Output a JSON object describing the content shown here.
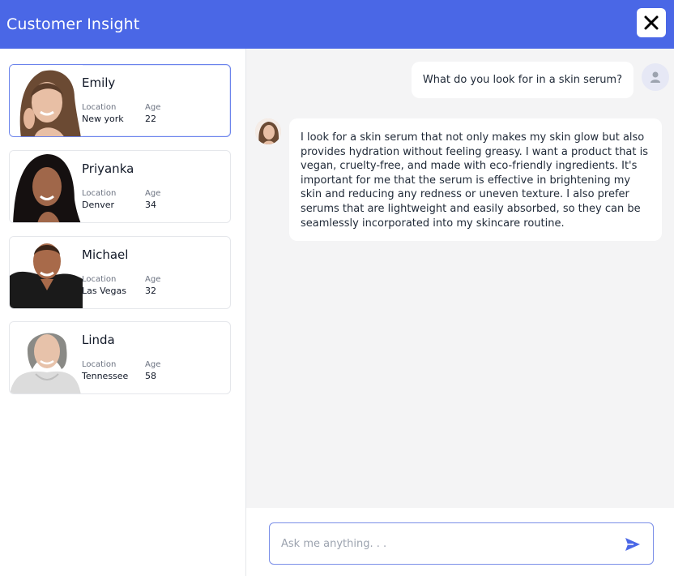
{
  "header": {
    "title": "Customer Insight"
  },
  "sidebar": {
    "personas": [
      {
        "name": "Emily",
        "location_label": "Location",
        "location": "New york",
        "age_label": "Age",
        "age": "22",
        "active": true
      },
      {
        "name": "Priyanka",
        "location_label": "Location",
        "location": "Denver",
        "age_label": "Age",
        "age": "34",
        "active": false
      },
      {
        "name": "Michael",
        "location_label": "Location",
        "location": "Las Vegas",
        "age_label": "Age",
        "age": "32",
        "active": false
      },
      {
        "name": "Linda",
        "location_label": "Location",
        "location": "Tennessee",
        "age_label": "Age",
        "age": "58",
        "active": false
      }
    ]
  },
  "chat": {
    "messages": [
      {
        "role": "user",
        "text": "What do you look for in a skin serum?"
      },
      {
        "role": "persona",
        "text": "I look for a skin serum that not only makes my skin glow but also provides hydration without feeling greasy. I want a product that is vegan, cruelty-free, and made with eco-friendly ingredients. It's important for me that the serum is effective in brightening my skin and reducing any redness or uneven texture. I also prefer serums that are lightweight and easily absorbed, so they can be seamlessly incorporated into my skincare routine."
      }
    ]
  },
  "composer": {
    "placeholder": "Ask me anything. . ."
  },
  "icons": {
    "close": "close-icon",
    "send": "send-icon",
    "user_avatar": "user-icon"
  },
  "colors": {
    "accent": "#4a67e6",
    "input_border": "#7b8fe8"
  }
}
